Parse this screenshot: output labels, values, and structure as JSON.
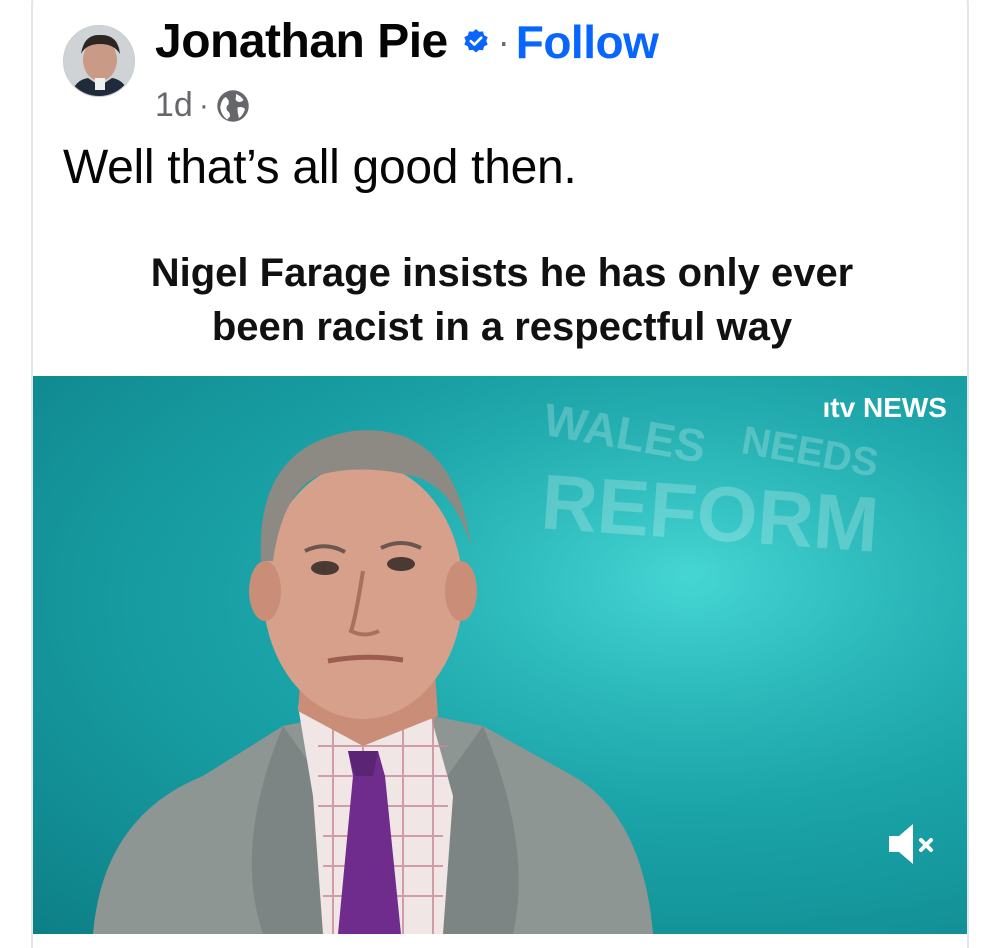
{
  "post": {
    "author": "Jonathan Pie",
    "follow_label": "Follow",
    "separator": "·",
    "timestamp": "1d",
    "audience_icon": "globe-icon",
    "verified_icon": "verified-badge-icon",
    "text": "Well that’s all good then."
  },
  "headline": {
    "line1": "Nigel Farage insists he has only ever",
    "line2": "been racist in a respectful way"
  },
  "video": {
    "logo": "ıtv NEWS",
    "backdrop_line1": "WALES",
    "backdrop_line2": "NEEDS",
    "backdrop_line3": "REFORM",
    "mute_icon": "speaker-muted-icon"
  },
  "colors": {
    "link": "#0866ff",
    "verified": "#0866ff",
    "meta": "#65676b",
    "video_bg": "#1aa6aa"
  }
}
